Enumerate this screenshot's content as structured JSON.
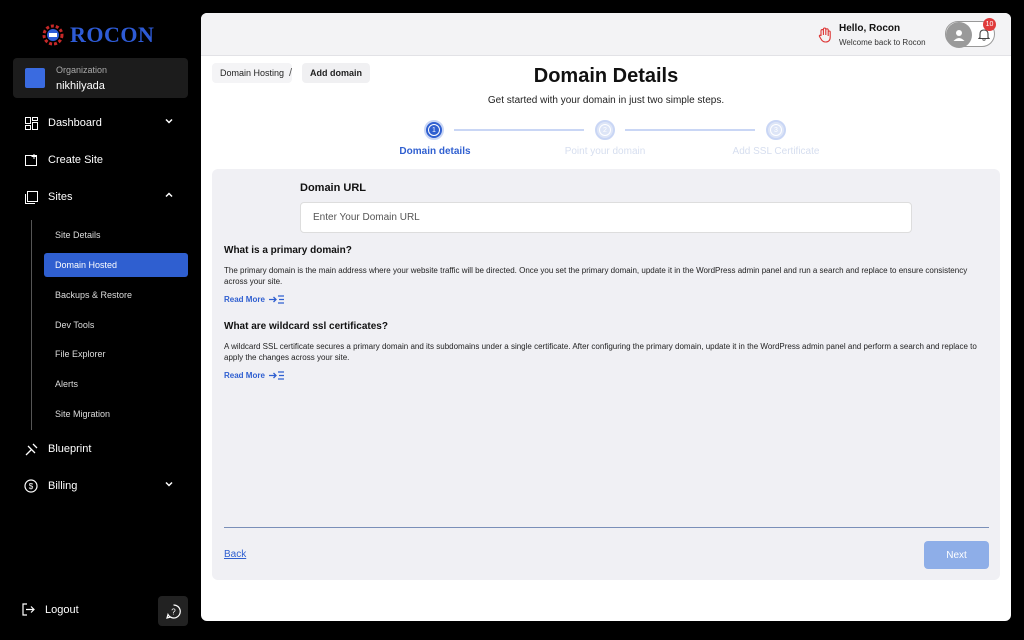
{
  "brand": {
    "name": "ROCON",
    "color": "#2e5bd6"
  },
  "organization": {
    "label": "Organization",
    "name": "nikhilyada"
  },
  "nav": {
    "dashboard": "Dashboard",
    "create_site": "Create Site",
    "sites": "Sites",
    "blueprint": "Blueprint",
    "billing": "Billing",
    "logout": "Logout"
  },
  "site_subnav": [
    {
      "label": "Site Details",
      "active": false
    },
    {
      "label": "Domain Hosted",
      "active": true
    },
    {
      "label": "Backups & Restore",
      "active": false
    },
    {
      "label": "Dev Tools",
      "active": false
    },
    {
      "label": "File Explorer",
      "active": false
    },
    {
      "label": "Alerts",
      "active": false
    },
    {
      "label": "Site Migration",
      "active": false
    }
  ],
  "header": {
    "greeting": "Hello, Rocon",
    "subtitle": "Welcome back to Rocon",
    "notification_count": "10"
  },
  "breadcrumb": {
    "first": "Domain Hosting",
    "separator": "/",
    "second": "Add domain"
  },
  "page": {
    "title": "Domain Details",
    "subtitle": "Get started with your domain in just two simple steps."
  },
  "steps": [
    {
      "number": "1",
      "label": "Domain details",
      "active": true
    },
    {
      "number": "2",
      "label": "Point your domain",
      "active": false
    },
    {
      "number": "3",
      "label": "Add SSL Certificate",
      "active": false
    }
  ],
  "form": {
    "url_label": "Domain URL",
    "url_placeholder": "Enter Your Domain URL",
    "url_value": ""
  },
  "faq": [
    {
      "question": "What is a primary domain?",
      "answer": "The primary domain is the main address where your website traffic will be directed. Once you set the primary domain, update it in the WordPress admin panel and run a search and replace to ensure consistency across your site.",
      "link": "Read More"
    },
    {
      "question": "What are wildcard ssl certificates?",
      "answer": "A wildcard SSL certificate secures a primary domain and its subdomains under a single certificate. After configuring the primary domain, update it in the WordPress admin panel and perform a search and replace to apply the changes across your site.",
      "link": "Read More"
    }
  ],
  "actions": {
    "back": "Back",
    "next": "Next"
  },
  "colors": {
    "accent": "#2f5fd0",
    "next_disabled": "#8eaee8",
    "badge": "#e03b3b"
  }
}
